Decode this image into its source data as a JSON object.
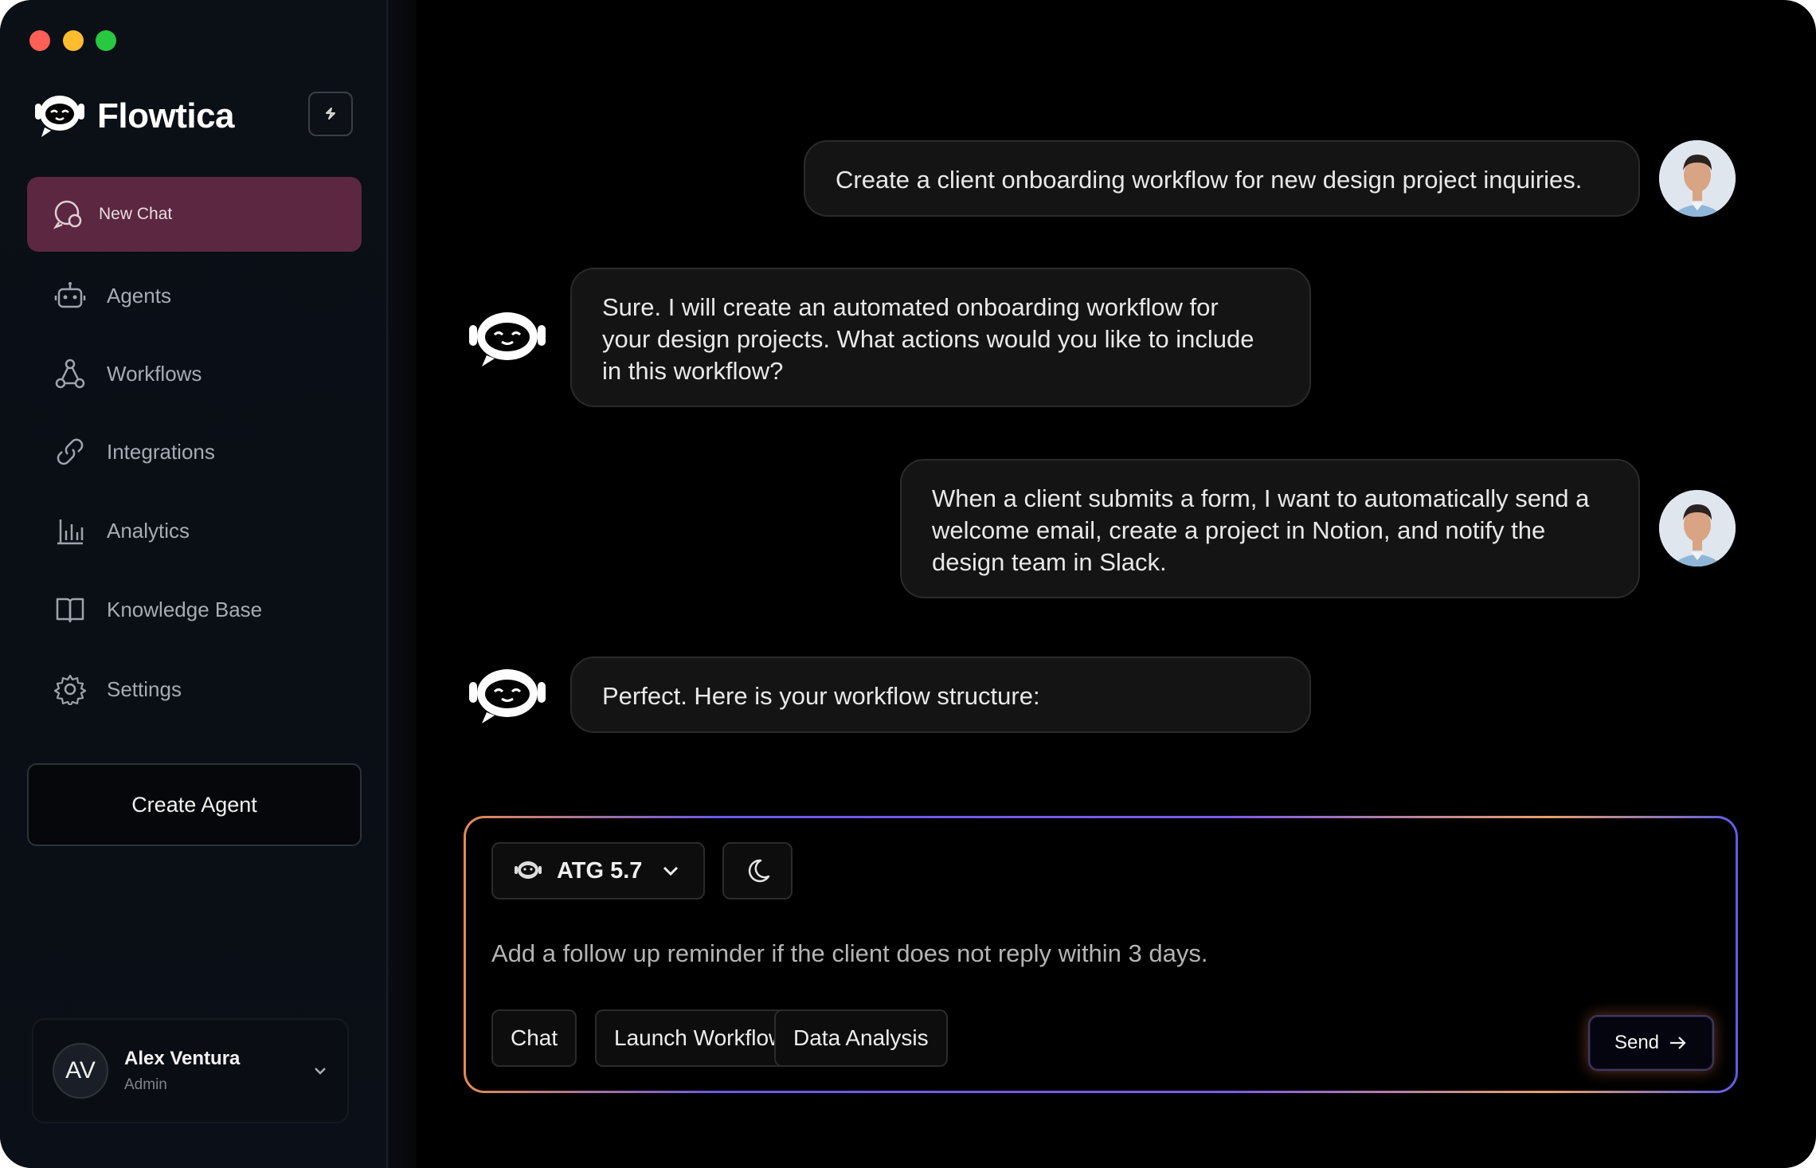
{
  "app": {
    "name": "Flowtica"
  },
  "sidebar": {
    "items": [
      {
        "label": "New Chat",
        "icon": "chat-plus-icon",
        "active": true
      },
      {
        "label": "Agents",
        "icon": "robot-icon"
      },
      {
        "label": "Workflows",
        "icon": "workflow-nodes-icon"
      },
      {
        "label": "Integrations",
        "icon": "link-icon"
      },
      {
        "label": "Analytics",
        "icon": "bar-chart-icon"
      },
      {
        "label": "Knowledge Base",
        "icon": "book-icon"
      },
      {
        "label": "Settings",
        "icon": "gear-icon"
      }
    ],
    "create_agent_label": "Create Agent",
    "user": {
      "initials": "AV",
      "name": "Alex Ventura",
      "role": "Admin"
    }
  },
  "chat": {
    "messages": [
      {
        "role": "user",
        "text": "Create a client onboarding workflow for new design project inquiries."
      },
      {
        "role": "assistant",
        "lines": [
          "Sure. I will create an automated onboarding workflow for",
          "your design projects. What actions would you like to include",
          "in this workflow?"
        ]
      },
      {
        "role": "user",
        "lines": [
          "When a client submits a form, I want to automatically send a",
          "welcome email, create a project in Notion, and notify the",
          "design team in Slack."
        ]
      },
      {
        "role": "assistant",
        "text": "Perfect. Here is your workflow structure:"
      }
    ]
  },
  "composer": {
    "model": "ATG 5.7",
    "input_value": "Add a follow up reminder if the client does not reply within 3 days.",
    "chips": [
      "Chat",
      "Launch Workflow",
      "Data Analysis"
    ],
    "send_label": "Send"
  },
  "colors": {
    "active_nav": "#5c2740",
    "background": "#000000",
    "sidebar": "#0b0f16",
    "bubble": "#141414"
  }
}
